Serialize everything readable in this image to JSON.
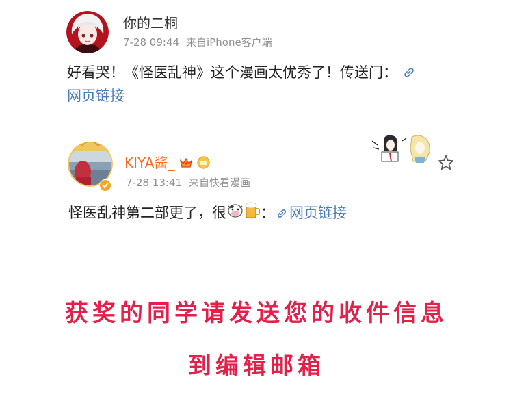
{
  "comments": [
    {
      "name": "你的二桐",
      "time": "7-28 09:44",
      "source": "来自iPhone客户端",
      "text": "好看哭！《怪医乱神》这个漫画太优秀了！传送门：",
      "link_label": "网页链接"
    },
    {
      "name": "KIYA酱_",
      "time": "7-28 13:41",
      "source": "来自快看漫画",
      "text": "怪医乱神第二部更了，很",
      "text_after": "：",
      "link_label": "网页链接"
    }
  ],
  "promo": {
    "line1": "获奖的同学请发送您的收件信息",
    "line2": "到编辑邮箱"
  },
  "colors": {
    "vip_name": "#f86a24",
    "link": "#4a7cb8",
    "promo": "#e3204a",
    "meta": "#8f8f8f",
    "verified": "#f5a623"
  },
  "icons": [
    "link-icon",
    "cow-emoji",
    "beer-emoji",
    "crown-badge",
    "medal-badge",
    "verified-badge",
    "star-icon"
  ]
}
